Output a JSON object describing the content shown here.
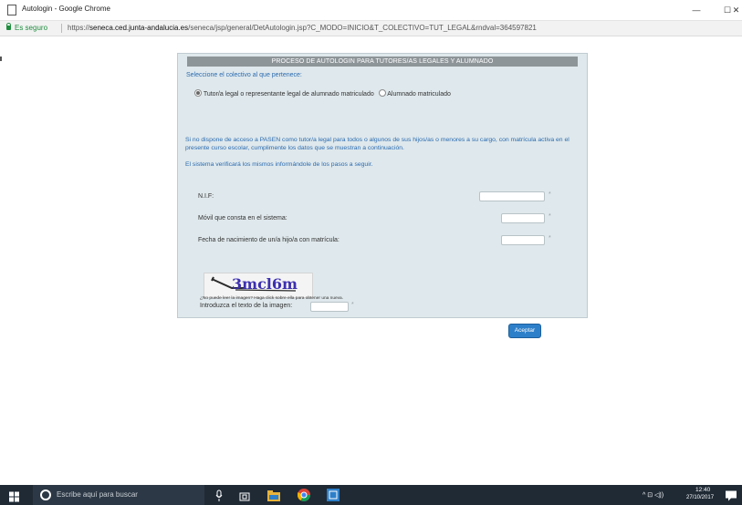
{
  "window": {
    "title": "Autologin - Google Chrome",
    "minimize": "—",
    "maximize": "☐",
    "close": "✕"
  },
  "address_bar": {
    "secure_label": "Es seguro",
    "url_scheme": "https://",
    "url_host": "seneca.ced.junta-andalucia.es",
    "url_path": "/seneca/jsp/general/DetAutologin.jsp?C_MODO=INICIO&T_COLECTIVO=TUT_LEGAL&rndval=364597821"
  },
  "form": {
    "header": "PROCESO DE AUTOLOGIN PARA TUTORES/AS LEGALES Y ALUMNADO",
    "collective_label": "Seleccione el colectivo al que pertenece:",
    "radio_tutor": "Tutor/a legal o representante legal de alumnado matriculado",
    "radio_alumnado": "Alumnado matriculado",
    "selected_option": "tutor",
    "info_text": "Si no dispone de acceso a PASEN como tutor/a legal para todos o algunos de sus hijos/as o menores a su cargo, con matrícula activa en el presente curso escolar, cumplimente los datos que se muestran a continuación.",
    "verify_text": "El sistema verificará los mismos informándole de los pasos a seguir.",
    "nif_label": "N.I.F:",
    "nif_value": "",
    "movil_label": "Móvil que consta en el sistema:",
    "movil_value": "",
    "fecha_label": "Fecha de nacimiento de un/a hijo/a con matrícula:",
    "fecha_value": "",
    "required_mark": "*",
    "captcha_text": "3mcl6m",
    "captcha_hint": "¿No puede leer la imagen? Haga click sobre ella para obtener una nueva.",
    "captcha_label": "Introduzca el texto de la imagen:",
    "captcha_value": "",
    "accept_label": "Aceptar"
  },
  "taskbar": {
    "search_placeholder": "Escribe aquí para buscar",
    "time": "12:40",
    "date": "27/10/2017",
    "tray_icons": "^ ⊡ ◁))"
  },
  "colors": {
    "panel_bg": "#dfe8ec",
    "header_bg": "#8e9599",
    "link_blue": "#2a6bb0",
    "button_blue": "#2d7fc9",
    "taskbar_bg": "#1f2a35"
  }
}
